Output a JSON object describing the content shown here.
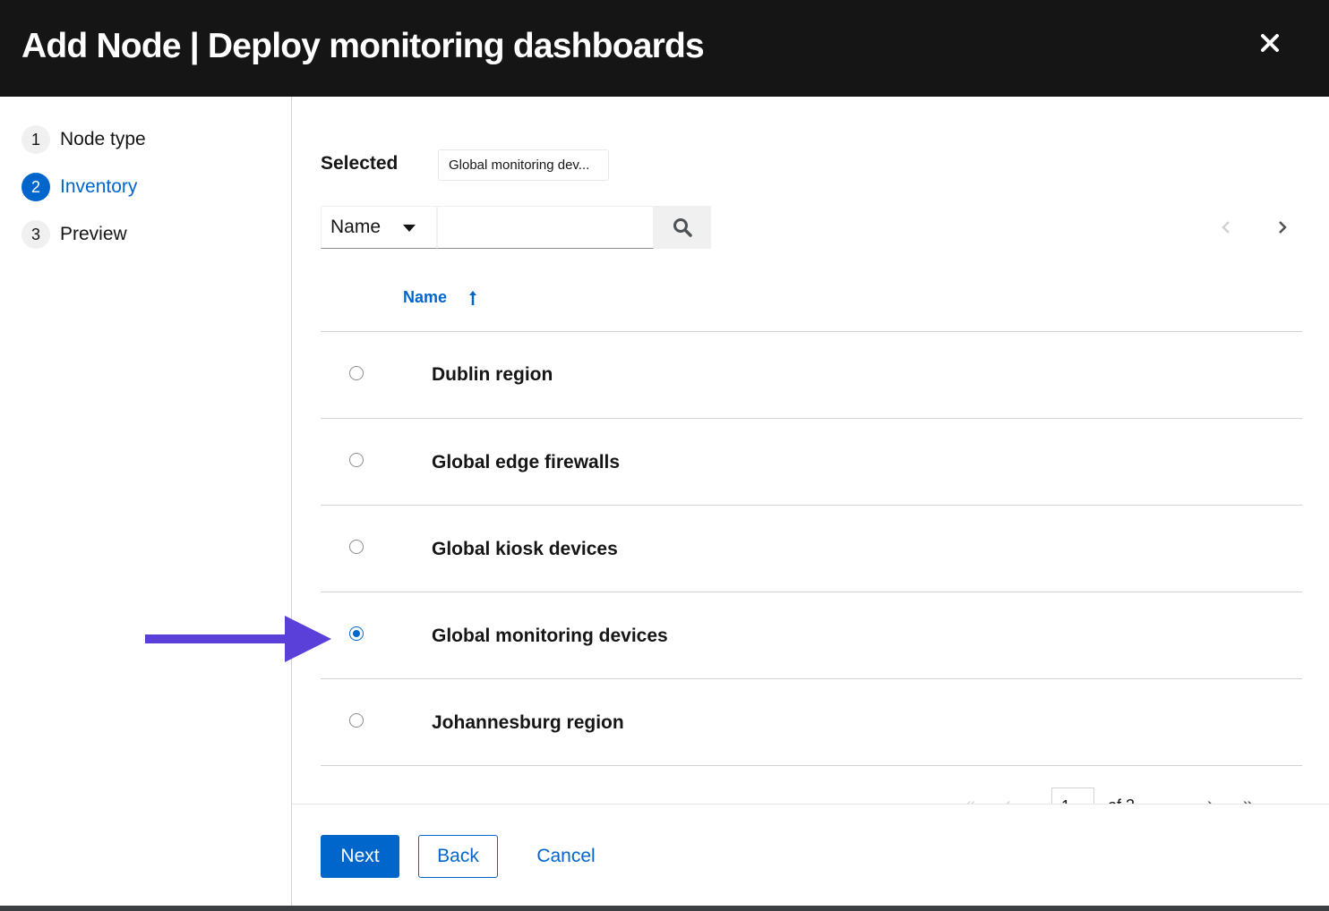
{
  "modal": {
    "title": "Add Node | Deploy monitoring dashboards"
  },
  "wizard": {
    "steps": [
      {
        "number": "1",
        "label": "Node type",
        "current": false
      },
      {
        "number": "2",
        "label": "Inventory",
        "current": true
      },
      {
        "number": "3",
        "label": "Preview",
        "current": false
      }
    ]
  },
  "selection": {
    "label": "Selected",
    "chip": "Global monitoring dev..."
  },
  "search": {
    "filter_field": "Name",
    "value": ""
  },
  "table": {
    "column_header": "Name",
    "sort": "ascending",
    "rows": [
      {
        "name": "Dublin region",
        "selected": false
      },
      {
        "name": "Global edge firewalls",
        "selected": false
      },
      {
        "name": "Global kiosk devices",
        "selected": false
      },
      {
        "name": "Global monitoring devices",
        "selected": true
      },
      {
        "name": "Johannesburg region",
        "selected": false
      }
    ]
  },
  "pagination": {
    "page": "1",
    "of_text": "of 2"
  },
  "footer": {
    "next_label": "Next",
    "back_label": "Back",
    "cancel_label": "Cancel"
  },
  "colors": {
    "header_bg": "#151515",
    "primary": "#0066cc",
    "annotation_arrow": "#5b3fd9"
  },
  "icons": [
    "close-icon",
    "caret-down-icon",
    "search-icon",
    "angle-left-icon",
    "angle-right-icon",
    "sort-up-arrow-icon",
    "angle-double-left-icon",
    "angle-double-right-icon"
  ]
}
